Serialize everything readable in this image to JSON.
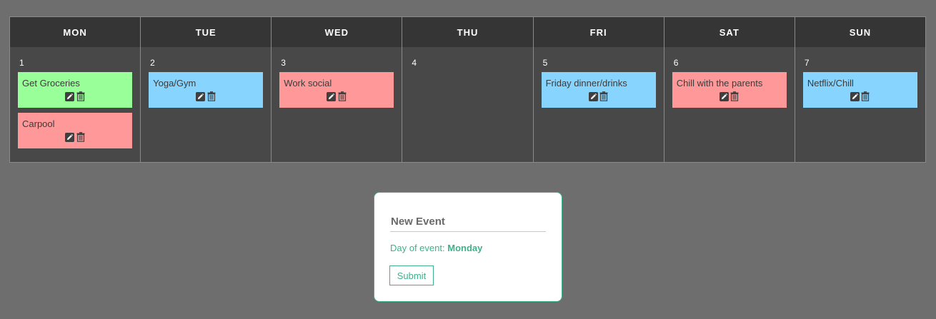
{
  "calendar": {
    "days": [
      {
        "name": "MON",
        "number": "1",
        "events": [
          {
            "title": "Get Groceries",
            "color": "#99ff99"
          },
          {
            "title": "Carpool",
            "color": "#ff9999"
          }
        ]
      },
      {
        "name": "TUE",
        "number": "2",
        "events": [
          {
            "title": "Yoga/Gym",
            "color": "#87d4ff"
          }
        ]
      },
      {
        "name": "WED",
        "number": "3",
        "events": [
          {
            "title": "Work social",
            "color": "#ff9999"
          }
        ]
      },
      {
        "name": "THU",
        "number": "4",
        "events": []
      },
      {
        "name": "FRI",
        "number": "5",
        "events": [
          {
            "title": "Friday dinner/drinks",
            "color": "#87d4ff"
          }
        ]
      },
      {
        "name": "SAT",
        "number": "6",
        "events": [
          {
            "title": "Chill with the parents",
            "color": "#ff9999"
          }
        ]
      },
      {
        "name": "SUN",
        "number": "7",
        "events": [
          {
            "title": "Netflix/Chill",
            "color": "#87d4ff"
          }
        ]
      }
    ],
    "event_actions": {
      "edit_icon": "pencil-icon",
      "delete_icon": "trash-icon"
    }
  },
  "form": {
    "title_placeholder": "New Event",
    "day_label": "Day of event:",
    "day_value": "Monday",
    "submit_label": "Submit",
    "accent_color": "#3fb18a"
  },
  "colors": {
    "page_bg": "#6e6e6e",
    "header_bg": "#353535",
    "body_bg": "#484848"
  }
}
